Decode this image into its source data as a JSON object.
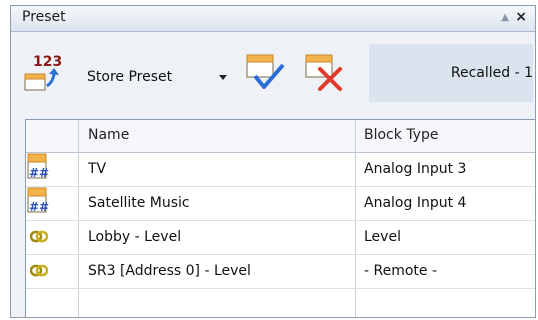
{
  "panel": {
    "title": "Preset",
    "pin_glyph": "▲",
    "close_glyph": "×"
  },
  "toolbar": {
    "store_icon_number": "123",
    "store_label": "Store Preset",
    "recalled_label": "Recalled - 1",
    "icons": {
      "store": "store-preset-icon",
      "recall": "recall-check-icon",
      "delete": "delete-preset-icon"
    }
  },
  "grid": {
    "columns": [
      "",
      "Name",
      "Block Type"
    ],
    "rows": [
      {
        "icon": "analog-input-icon",
        "name": "TV",
        "type": "Analog Input 3"
      },
      {
        "icon": "analog-input-icon",
        "name": "Satellite Music",
        "type": "Analog Input 4"
      },
      {
        "icon": "link-icon",
        "name": "Lobby - Level",
        "type": "Level"
      },
      {
        "icon": "link-icon",
        "name": "SR3 [Address 0] - Level",
        "type": "- Remote -"
      }
    ]
  },
  "colors": {
    "panel_bg": "#eef2f7",
    "accent_orange": "#f4b24a",
    "check_blue": "#2b6fd6",
    "delete_red": "#e03a2a",
    "hash_blue": "#2a4fb8"
  }
}
